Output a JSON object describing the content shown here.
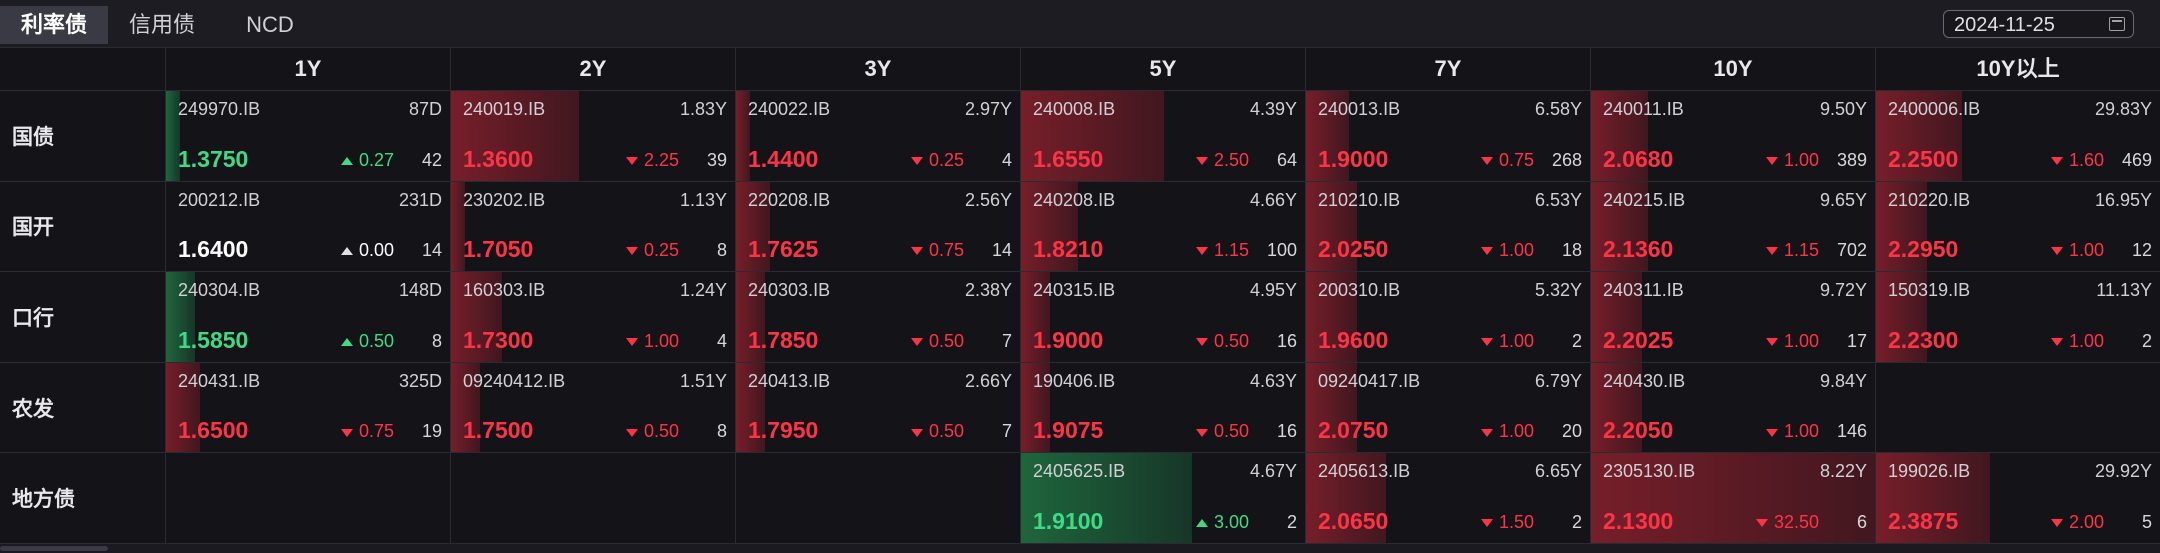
{
  "tabs": [
    "利率债",
    "信用债",
    "NCD"
  ],
  "date": "2024-11-25",
  "columns": [
    "1Y",
    "2Y",
    "3Y",
    "5Y",
    "7Y",
    "10Y",
    "10Y以上"
  ],
  "rows": [
    {
      "label": "国债",
      "cells": [
        {
          "code": "249970.IB",
          "term": "87D",
          "yield": "1.3750",
          "change": "0.27",
          "count": "42",
          "dir": "up",
          "color": "green",
          "bar": 0.05
        },
        {
          "code": "240019.IB",
          "term": "1.83Y",
          "yield": "1.3600",
          "change": "2.25",
          "count": "39",
          "dir": "down",
          "color": "red",
          "bar": 0.45
        },
        {
          "code": "240022.IB",
          "term": "2.97Y",
          "yield": "1.4400",
          "change": "0.25",
          "count": "4",
          "dir": "down",
          "color": "red",
          "bar": 0.05
        },
        {
          "code": "240008.IB",
          "term": "4.39Y",
          "yield": "1.6550",
          "change": "2.50",
          "count": "64",
          "dir": "down",
          "color": "red",
          "bar": 0.5
        },
        {
          "code": "240013.IB",
          "term": "6.58Y",
          "yield": "1.9000",
          "change": "0.75",
          "count": "268",
          "dir": "down",
          "color": "red",
          "bar": 0.15
        },
        {
          "code": "240011.IB",
          "term": "9.50Y",
          "yield": "2.0680",
          "change": "1.00",
          "count": "389",
          "dir": "down",
          "color": "red",
          "bar": 0.2
        },
        {
          "code": "2400006.IB",
          "term": "29.83Y",
          "yield": "2.2500",
          "change": "1.60",
          "count": "469",
          "dir": "down",
          "color": "red",
          "bar": 0.3
        }
      ]
    },
    {
      "label": "国开",
      "cells": [
        {
          "code": "200212.IB",
          "term": "231D",
          "yield": "1.6400",
          "change": "0.00",
          "count": "14",
          "dir": "flat",
          "color": "white",
          "bar": 0
        },
        {
          "code": "230202.IB",
          "term": "1.13Y",
          "yield": "1.7050",
          "change": "0.25",
          "count": "8",
          "dir": "down",
          "color": "red",
          "bar": 0.05
        },
        {
          "code": "220208.IB",
          "term": "2.56Y",
          "yield": "1.7625",
          "change": "0.75",
          "count": "14",
          "dir": "down",
          "color": "red",
          "bar": 0.12
        },
        {
          "code": "240208.IB",
          "term": "4.66Y",
          "yield": "1.8210",
          "change": "1.15",
          "count": "100",
          "dir": "down",
          "color": "red",
          "bar": 0.2
        },
        {
          "code": "210210.IB",
          "term": "6.53Y",
          "yield": "2.0250",
          "change": "1.00",
          "count": "18",
          "dir": "down",
          "color": "red",
          "bar": 0.18
        },
        {
          "code": "240215.IB",
          "term": "9.65Y",
          "yield": "2.1360",
          "change": "1.15",
          "count": "702",
          "dir": "down",
          "color": "red",
          "bar": 0.2
        },
        {
          "code": "210220.IB",
          "term": "16.95Y",
          "yield": "2.2950",
          "change": "1.00",
          "count": "12",
          "dir": "down",
          "color": "red",
          "bar": 0.18
        }
      ]
    },
    {
      "label": "口行",
      "cells": [
        {
          "code": "240304.IB",
          "term": "148D",
          "yield": "1.5850",
          "change": "0.50",
          "count": "8",
          "dir": "up",
          "color": "green",
          "bar": 0.1
        },
        {
          "code": "160303.IB",
          "term": "1.24Y",
          "yield": "1.7300",
          "change": "1.00",
          "count": "4",
          "dir": "down",
          "color": "red",
          "bar": 0.18
        },
        {
          "code": "240303.IB",
          "term": "2.38Y",
          "yield": "1.7850",
          "change": "0.50",
          "count": "7",
          "dir": "down",
          "color": "red",
          "bar": 0.1
        },
        {
          "code": "240315.IB",
          "term": "4.95Y",
          "yield": "1.9000",
          "change": "0.50",
          "count": "16",
          "dir": "down",
          "color": "red",
          "bar": 0.1
        },
        {
          "code": "200310.IB",
          "term": "5.32Y",
          "yield": "1.9600",
          "change": "1.00",
          "count": "2",
          "dir": "down",
          "color": "red",
          "bar": 0.18
        },
        {
          "code": "240311.IB",
          "term": "9.72Y",
          "yield": "2.2025",
          "change": "1.00",
          "count": "17",
          "dir": "down",
          "color": "red",
          "bar": 0.18
        },
        {
          "code": "150319.IB",
          "term": "11.13Y",
          "yield": "2.2300",
          "change": "1.00",
          "count": "2",
          "dir": "down",
          "color": "red",
          "bar": 0.18
        }
      ]
    },
    {
      "label": "农发",
      "cells": [
        {
          "code": "240431.IB",
          "term": "325D",
          "yield": "1.6500",
          "change": "0.75",
          "count": "19",
          "dir": "down",
          "color": "red",
          "bar": 0.12
        },
        {
          "code": "09240412.IB",
          "term": "1.51Y",
          "yield": "1.7500",
          "change": "0.50",
          "count": "8",
          "dir": "down",
          "color": "red",
          "bar": 0.1
        },
        {
          "code": "240413.IB",
          "term": "2.66Y",
          "yield": "1.7950",
          "change": "0.50",
          "count": "7",
          "dir": "down",
          "color": "red",
          "bar": 0.1
        },
        {
          "code": "190406.IB",
          "term": "4.63Y",
          "yield": "1.9075",
          "change": "0.50",
          "count": "16",
          "dir": "down",
          "color": "red",
          "bar": 0.1
        },
        {
          "code": "09240417.IB",
          "term": "6.79Y",
          "yield": "2.0750",
          "change": "1.00",
          "count": "20",
          "dir": "down",
          "color": "red",
          "bar": 0.18
        },
        {
          "code": "240430.IB",
          "term": "9.84Y",
          "yield": "2.2050",
          "change": "1.00",
          "count": "146",
          "dir": "down",
          "color": "red",
          "bar": 0.18
        },
        null
      ]
    },
    {
      "label": "地方债",
      "cells": [
        null,
        null,
        null,
        {
          "code": "2405625.IB",
          "term": "4.67Y",
          "yield": "1.9100",
          "change": "3.00",
          "count": "2",
          "dir": "up",
          "color": "green",
          "bar": 0.6
        },
        {
          "code": "2405613.IB",
          "term": "6.65Y",
          "yield": "2.0650",
          "change": "1.50",
          "count": "2",
          "dir": "down",
          "color": "red",
          "bar": 0.28
        },
        {
          "code": "2305130.IB",
          "term": "8.22Y",
          "yield": "2.1300",
          "change": "32.50",
          "count": "6",
          "dir": "down",
          "color": "red",
          "bar": 1.0
        },
        {
          "code": "199026.IB",
          "term": "29.92Y",
          "yield": "2.3875",
          "change": "2.00",
          "count": "5",
          "dir": "down",
          "color": "red",
          "bar": 0.4
        }
      ]
    }
  ]
}
